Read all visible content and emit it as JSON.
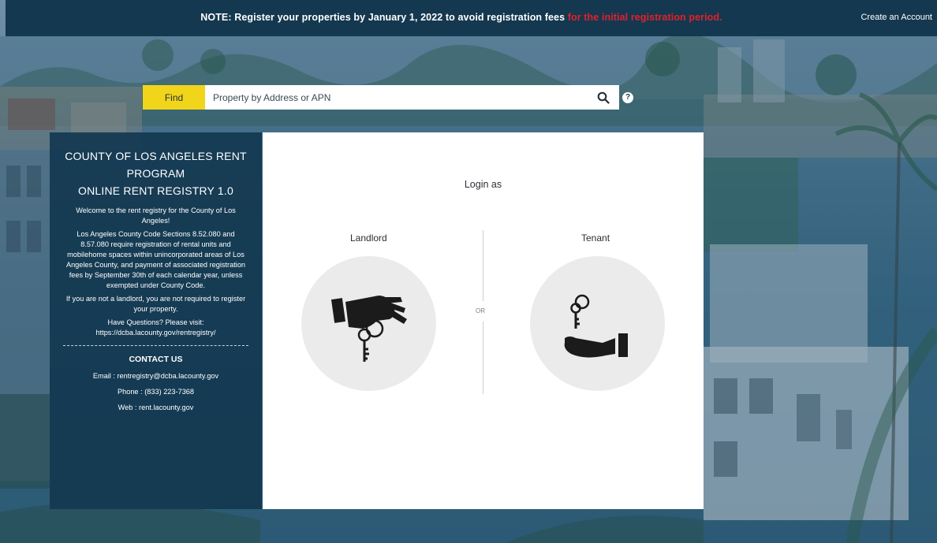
{
  "topbar": {
    "notice_main": "NOTE: Register your properties by January 1, 2022 to avoid registration fees",
    "notice_highlight": "for the initial registration period.",
    "create_account": "Create an Account",
    "highlight_color": "#e3202a"
  },
  "search": {
    "find_label": "Find",
    "placeholder": "Property by Address or APN",
    "value": "",
    "search_icon": "search-icon",
    "help_icon": "question-circle-icon",
    "help_glyph": "?"
  },
  "info": {
    "title_line1": "COUNTY OF LOS ANGELES RENT",
    "title_line2": "PROGRAM",
    "title_line3": "ONLINE RENT REGISTRY 1.0",
    "welcome": "Welcome to the rent registry for the County of Los Angeles!",
    "code_text": "Los Angeles County Code Sections 8.52.080 and 8.57.080 require registration of rental units and mobilehome spaces within unincorporated areas of Los Angeles County, and payment of associated registration fees by September 30th of each calendar year, unless exempted under County Code.",
    "not_landlord": "If you are not a landlord, you are not required to register your property.",
    "questions": "Have Questions? Please visit:",
    "questions_url": "https://dcba.lacounty.gov/rentregistry/",
    "contact_title": "CONTACT US",
    "email": "Email : rentregistry@dcba.lacounty.gov",
    "phone": "Phone : (833) 223-7368",
    "web": "Web : rent.lacounty.gov"
  },
  "login": {
    "title": "Login as",
    "landlord_label": "Landlord",
    "tenant_label": "Tenant",
    "or_label": "OR",
    "landlord_icon": "hand-holding-keys-icon",
    "tenant_icon": "hand-receiving-key-icon"
  },
  "colors": {
    "topbar_bg": "#14384f",
    "find_bg": "#f1d51a",
    "panel_bg": "#143850",
    "circle_bg": "#ebebeb"
  }
}
